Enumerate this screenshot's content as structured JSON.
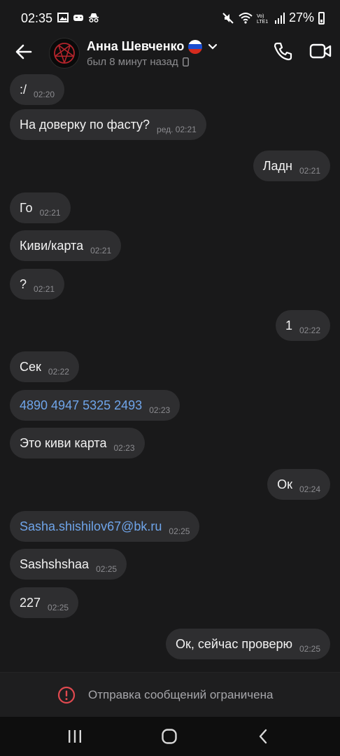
{
  "status_bar": {
    "time": "02:35",
    "battery": "27%",
    "icons": [
      "gallery-icon",
      "gamepad-icon",
      "incognito-icon",
      "mute-icon",
      "wifi-icon",
      "volte-icon",
      "signal-icon",
      "battery-icon"
    ]
  },
  "header": {
    "contact_name": "Анна Шевченко",
    "last_seen": "был 8 минут назад",
    "icons": [
      "back-arrow-icon",
      "avatar",
      "russian-flag-icon",
      "chevron-down-icon",
      "phone-icon",
      "video-call-icon"
    ]
  },
  "messages": [
    {
      "side": "in",
      "text": ":/",
      "time": "02:20"
    },
    {
      "side": "in",
      "text": "На доверку по фасту?",
      "time": "ред. 02:21"
    },
    {
      "side": "out",
      "text": "Ладн",
      "time": "02:21"
    },
    {
      "side": "in",
      "text": "Го",
      "time": "02:21"
    },
    {
      "side": "in",
      "text": "Киви/карта",
      "time": "02:21"
    },
    {
      "side": "in",
      "text": "?",
      "time": "02:21"
    },
    {
      "side": "out",
      "text": "1",
      "time": "02:22"
    },
    {
      "side": "in",
      "text": "Сек",
      "time": "02:22"
    },
    {
      "side": "in",
      "text": "4890 4947 5325 2493",
      "time": "02:23",
      "link": true
    },
    {
      "side": "in",
      "text": "Это киви карта",
      "time": "02:23"
    },
    {
      "side": "out",
      "text": "Ок",
      "time": "02:24"
    },
    {
      "side": "in",
      "text": "Sasha.shishilov67@bk.ru",
      "time": "02:25",
      "link": true
    },
    {
      "side": "in",
      "text": "Sashshshaa",
      "time": "02:25"
    },
    {
      "side": "in",
      "text": "227",
      "time": "02:25"
    },
    {
      "side": "out",
      "text": "Ок, сейчас проверю",
      "time": "02:25"
    }
  ],
  "restriction": {
    "text": "Отправка сообщений ограничена"
  },
  "colors": {
    "background": "#19191a",
    "bubble": "#2e2e30",
    "link": "#6fa5ea",
    "warning": "#e0494f"
  }
}
